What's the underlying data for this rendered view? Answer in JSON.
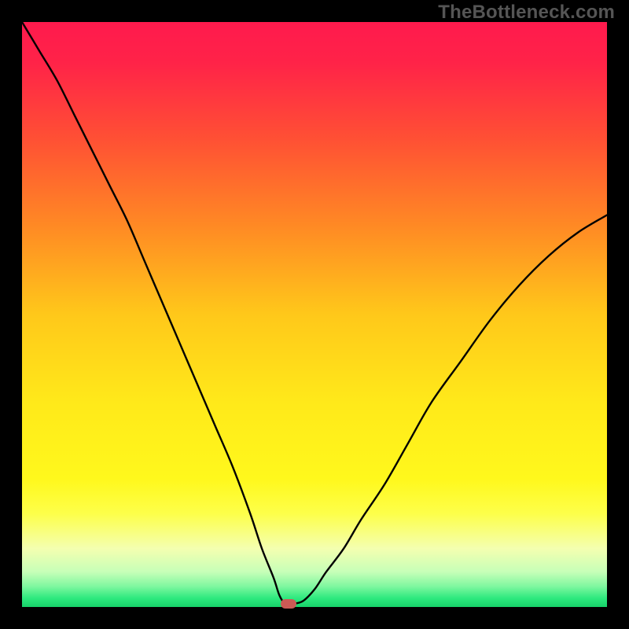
{
  "watermark": "TheBottleneck.com",
  "chart_data": {
    "type": "line",
    "title": "",
    "xlabel": "",
    "ylabel": "",
    "xlim": [
      0,
      100
    ],
    "ylim": [
      0,
      100
    ],
    "grid": false,
    "legend": false,
    "gradient_stops": [
      {
        "offset": 0.0,
        "color": "#ff1a4d"
      },
      {
        "offset": 0.07,
        "color": "#ff2348"
      },
      {
        "offset": 0.2,
        "color": "#ff5034"
      },
      {
        "offset": 0.35,
        "color": "#ff8a24"
      },
      {
        "offset": 0.5,
        "color": "#ffc81a"
      },
      {
        "offset": 0.65,
        "color": "#ffe91a"
      },
      {
        "offset": 0.78,
        "color": "#fff81c"
      },
      {
        "offset": 0.84,
        "color": "#fdff49"
      },
      {
        "offset": 0.9,
        "color": "#f4ffb0"
      },
      {
        "offset": 0.94,
        "color": "#c7ffb8"
      },
      {
        "offset": 0.965,
        "color": "#7ef79f"
      },
      {
        "offset": 0.985,
        "color": "#2de97e"
      },
      {
        "offset": 1.0,
        "color": "#17d26a"
      }
    ],
    "series": [
      {
        "name": "bottleneck-curve",
        "color": "#000000",
        "x": [
          0,
          3,
          6,
          9,
          12,
          15,
          18,
          21,
          24,
          27,
          30,
          33,
          36,
          39,
          41,
          43,
          44,
          45,
          46,
          48,
          50,
          52,
          55,
          58,
          62,
          66,
          70,
          75,
          80,
          85,
          90,
          95,
          100
        ],
        "y": [
          100,
          95,
          90,
          84,
          78,
          72,
          66,
          59,
          52,
          45,
          38,
          31,
          24,
          16,
          10,
          5,
          2,
          0.5,
          0.5,
          1,
          3,
          6,
          10,
          15,
          21,
          28,
          35,
          42,
          49,
          55,
          60,
          64,
          67
        ]
      }
    ],
    "marker": {
      "x": 45.5,
      "y": 0.5,
      "color": "#cc5a55"
    }
  }
}
